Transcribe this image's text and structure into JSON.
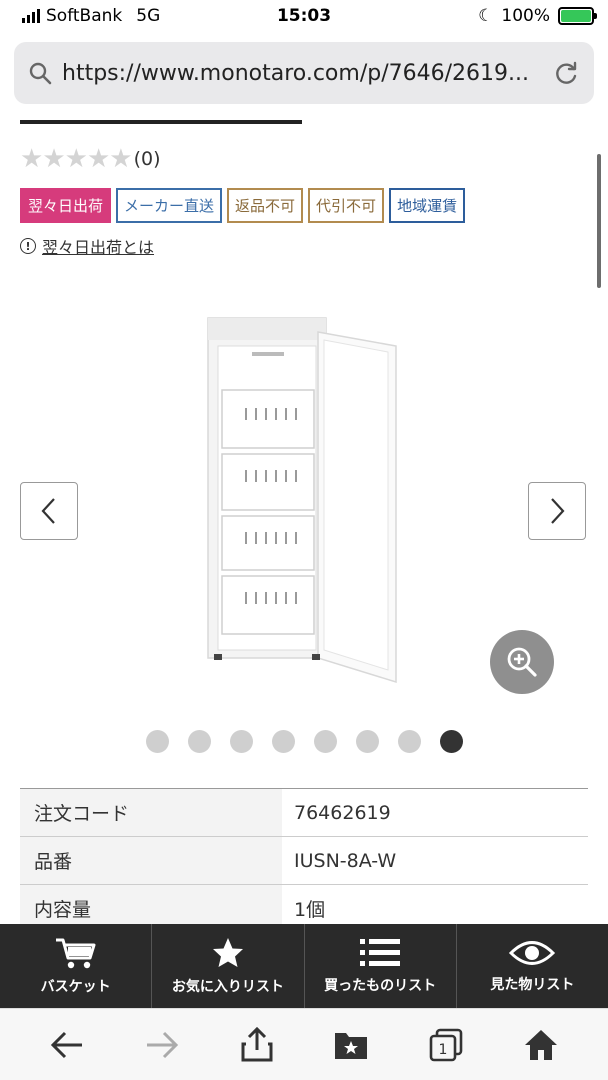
{
  "status_bar": {
    "carrier": "SoftBank",
    "network": "5G",
    "time": "15:03",
    "battery_pct": "100%"
  },
  "browser": {
    "url": "https://www.monotaro.com/p/7646/2619..."
  },
  "product": {
    "rating_count": "(0)",
    "badges": [
      "翌々日出荷",
      "メーカー直送",
      "返品不可",
      "代引不可",
      "地域運賃"
    ],
    "info_link": "翌々日出荷とは",
    "carousel": {
      "total": 8,
      "active_index": 7
    }
  },
  "specs": [
    {
      "key": "注文コード",
      "value": "76462619"
    },
    {
      "key": "品番",
      "value": "IUSN-8A-W"
    },
    {
      "key": "内容量",
      "value": "1個"
    }
  ],
  "bottom_nav": {
    "basket": "バスケット",
    "favorites": "お気に入りリスト",
    "purchased": "買ったものリスト",
    "viewed": "見た物リスト"
  },
  "colors": {
    "next_day_badge": "#d63b7c",
    "bottom_nav_bg": "#2a2a2a"
  }
}
